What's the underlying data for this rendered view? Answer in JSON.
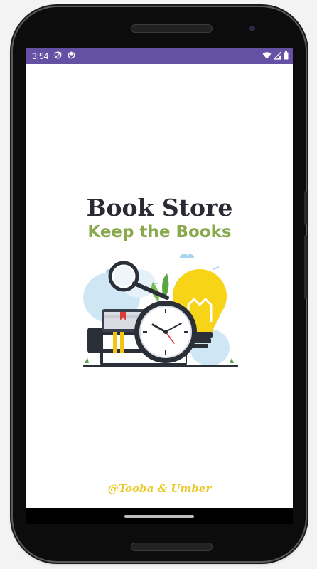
{
  "status_bar": {
    "time": "3:54",
    "icons_left": [
      "shield-icon",
      "circle-face-icon"
    ],
    "icons_right": [
      "wifi-icon",
      "signal-icon",
      "battery-icon"
    ],
    "color": "#6650a4"
  },
  "splash": {
    "title": "Book Store",
    "subtitle": "Keep the Books",
    "illustration": "books-clock-lightbulb-illustration",
    "credit": "@Tooba & Umber"
  },
  "colors": {
    "title": "#2a2a33",
    "subtitle": "#8aa84e",
    "credit": "#e9c928"
  }
}
